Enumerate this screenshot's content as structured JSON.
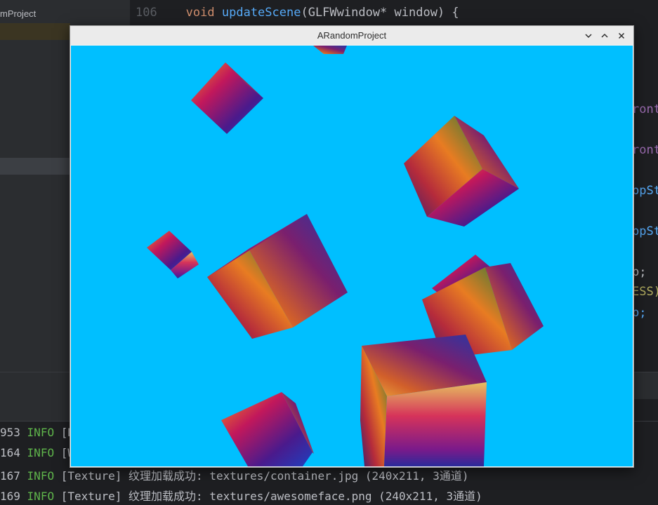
{
  "ide": {
    "project_fragment": "mProject",
    "line_number": "106",
    "code_keyword": "void",
    "code_function": "updateScene",
    "code_rest": "(GLFWwindow* window) {",
    "right_fragments": [
      "ront",
      "ront",
      "ppSt",
      "ppSt",
      "p;",
      "ESS)",
      "p;"
    ],
    "console_lines": [
      {
        "prefix": "953",
        "level": "INFO",
        "text": "[N"
      },
      {
        "prefix": "164",
        "level": "INFO",
        "text": "[W"
      },
      {
        "prefix": "167",
        "level": "INFO",
        "text": "[Texture] 纹理加载成功: textures/container.jpg (240x211, 3通道)"
      },
      {
        "prefix": "169",
        "level": "INFO",
        "text": "[Texture] 纹理加载成功: textures/awesomeface.png (240x211, 3通道)"
      }
    ]
  },
  "window": {
    "title": "ARandomProject",
    "minimize_icon": "chevron-down-icon",
    "maximize_icon": "chevron-up-icon",
    "close_icon": "close-icon",
    "scene_background": "#00bfff"
  },
  "colors": {
    "accent_info": "#5fb54b",
    "keyword": "#cf8e6d",
    "function": "#57aaf7"
  }
}
